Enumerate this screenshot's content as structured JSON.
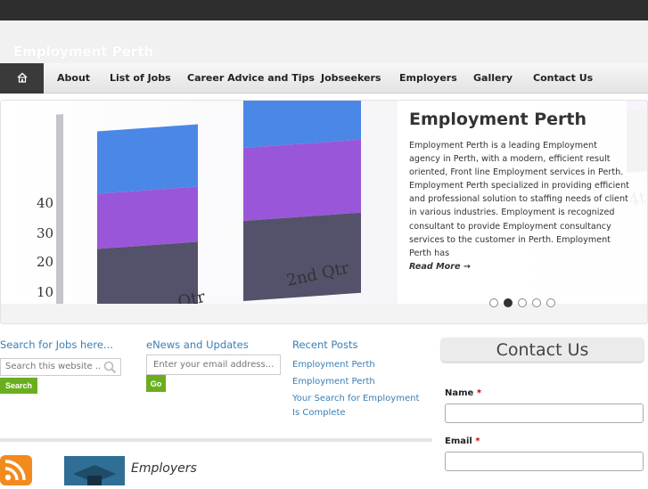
{
  "site": {
    "title": "Employment Perth"
  },
  "nav": {
    "home_icon": "home-icon",
    "items": [
      {
        "label": "About"
      },
      {
        "label": "List of Jobs"
      },
      {
        "label": "Career Advice and Tips"
      },
      {
        "label": "Jobseekers"
      },
      {
        "label": "Employers"
      },
      {
        "label": "Gallery"
      },
      {
        "label": "Contact Us"
      }
    ]
  },
  "slider": {
    "image_axis_labels": [
      "10",
      "20",
      "30",
      "40"
    ],
    "image_category_labels": [
      "Qtr",
      "2nd Qtr",
      "4t"
    ],
    "title": "Employment Perth",
    "body": "Employment Perth is a leading Employment agency in Perth, with a modern, efficient result oriented, Front line Employment services in Perth. Employment Perth specialized in providing efficient and professional solution to staffing needs of client in various industries. Employment is recognized consultant to provide Employment consultancy services to the customer in Perth. Employment Perth has",
    "read_more": "Read More →",
    "dot_count": 5,
    "active_slide": 2
  },
  "widgets": {
    "search": {
      "title": "Search for Jobs here...",
      "placeholder": "Search this website ...",
      "button": "Search"
    },
    "enews": {
      "title": "eNews and Updates",
      "placeholder": "Enter your email address...",
      "button": "Go"
    },
    "recent_posts": {
      "title": "Recent Posts",
      "items": [
        {
          "label": "Employment Perth"
        },
        {
          "label": "Employment Perth"
        },
        {
          "label": "Your Search for Employment Is Complete"
        }
      ]
    }
  },
  "contact": {
    "title": "Contact Us",
    "name_label": "Name",
    "email_label": "Email",
    "required_mark": "*"
  },
  "bottom": {
    "employers_title": "Employers",
    "rss_icon": "rss-icon"
  },
  "colors": {
    "accent_link": "#3b7fb5",
    "button_green": "#6aae1f",
    "topbar": "#2e2e2e"
  }
}
